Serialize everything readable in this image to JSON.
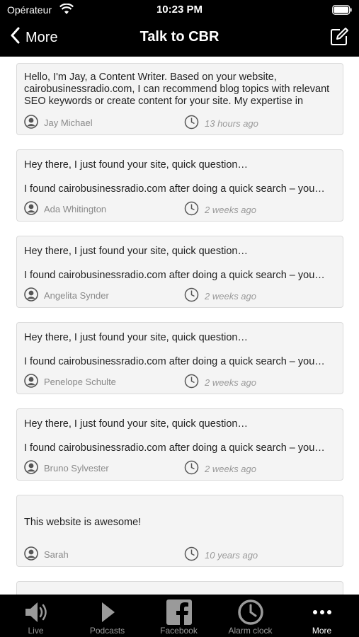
{
  "status_bar": {
    "carrier": "Opérateur",
    "time": "10:23 PM"
  },
  "nav": {
    "back_label": "More",
    "title": "Talk to CBR"
  },
  "messages": [
    {
      "text": "Hello, I'm Jay, a Content Writer. Based on your website, cairobusinessradio.com, I can recommend blog topics with relevant SEO keywords or create content for your site. My expertise in various industries ensures high-quality content…",
      "author": "Jay Michael",
      "time": "13 hours ago"
    },
    {
      "subject": "Hey there, I just found your site, quick question…",
      "text": "I found cairobusinessradio.com after doing a quick search – you…",
      "author": "Ada Whitington",
      "time": "2 weeks ago"
    },
    {
      "subject": "Hey there, I just found your site, quick question…",
      "text": "I found cairobusinessradio.com after doing a quick search – you…",
      "author": "Angelita Synder",
      "time": "2 weeks ago"
    },
    {
      "subject": "Hey there, I just found your site, quick question…",
      "text": "I found cairobusinessradio.com after doing a quick search – you…",
      "author": "Penelope Schulte",
      "time": "2 weeks ago"
    },
    {
      "subject": "Hey there, I just found your site, quick question…",
      "text": "I found cairobusinessradio.com after doing a quick search – you…",
      "author": "Bruno Sylvester",
      "time": "2 weeks ago"
    },
    {
      "text": "This website is awesome!",
      "author": "Sarah",
      "time": "10 years ago"
    }
  ],
  "tabs": [
    {
      "label": "Live",
      "icon": "speaker-icon"
    },
    {
      "label": "Podcasts",
      "icon": "play-icon"
    },
    {
      "label": "Facebook",
      "icon": "facebook-icon"
    },
    {
      "label": "Alarm clock",
      "icon": "alarm-clock-icon"
    },
    {
      "label": "More",
      "icon": "more-dots-icon",
      "active": true
    }
  ]
}
